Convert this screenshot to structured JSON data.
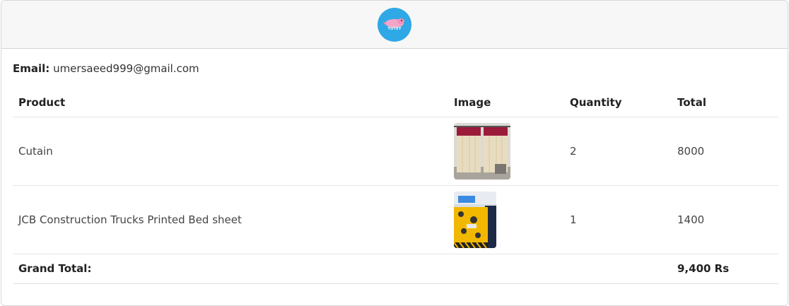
{
  "header": {
    "logo_icon": "brand-logo-icon",
    "logo_text": "TOTEY",
    "logo_color": "#2fa8e6"
  },
  "email": {
    "label": "Email:",
    "value": "umersaeed999@gmail.com"
  },
  "table": {
    "headers": [
      "Product",
      "Image",
      "Quantity",
      "Total"
    ],
    "rows": [
      {
        "product": "Cutain",
        "image_icon": "curtain-image",
        "quantity": "2",
        "total": "8000"
      },
      {
        "product": "JCB Construction Trucks Printed Bed sheet",
        "image_icon": "bedsheet-image",
        "quantity": "1",
        "total": "1400"
      }
    ],
    "grand_total_label": "Grand Total:",
    "grand_total_value": "9,400 Rs"
  }
}
